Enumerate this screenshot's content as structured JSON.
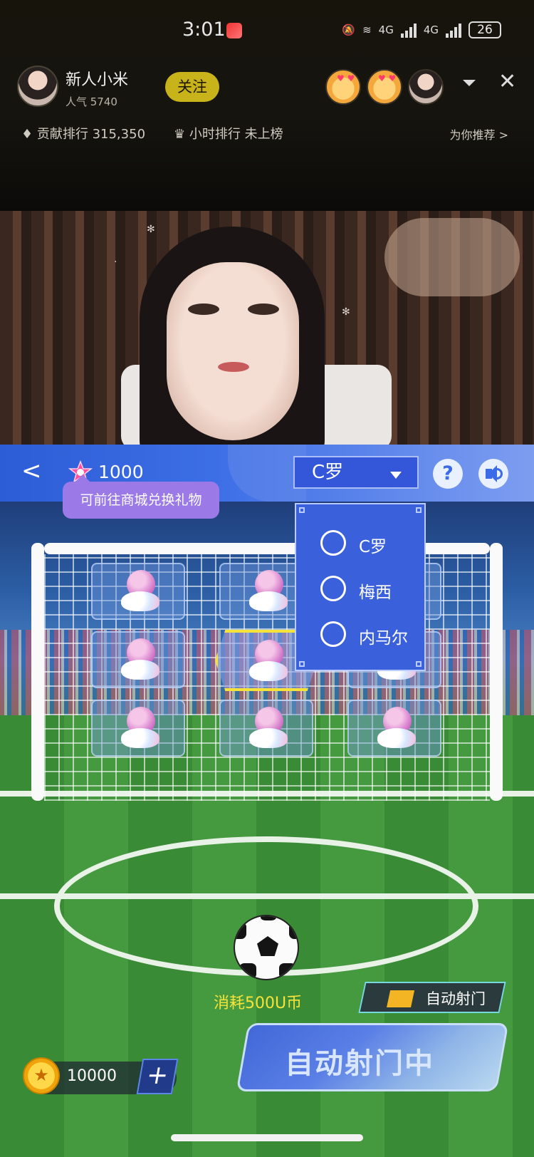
{
  "status_bar": {
    "time": "3:01",
    "network_1": "4G",
    "network_2": "4G",
    "battery": "26"
  },
  "streamer": {
    "name": "新人小米",
    "popularity": "人气 5740",
    "follow_label": "关注"
  },
  "ranks": {
    "contribution": "贡献排行 315,350",
    "hourly": "小时排行 未上榜",
    "recommend": "为你推荐 >"
  },
  "game": {
    "star_points": "1000",
    "selected_player": "C罗",
    "tooltip": "可前往商城兑换礼物",
    "help_label": "?",
    "player_options": [
      {
        "label": "C罗"
      },
      {
        "label": "梅西"
      },
      {
        "label": "内马尔"
      }
    ],
    "cost_label": "消耗500U币",
    "auto_shoot_toggle_label": "自动射门",
    "auto_shoot_status": "自动射门中",
    "coin_balance": "10000",
    "add_label": "+"
  },
  "colors": {
    "accent_blue": "#3a60dc",
    "follow_yellow": "#c8b41a",
    "cost_yellow": "#f7e33a",
    "tooltip_purple": "#9b7ae8"
  }
}
